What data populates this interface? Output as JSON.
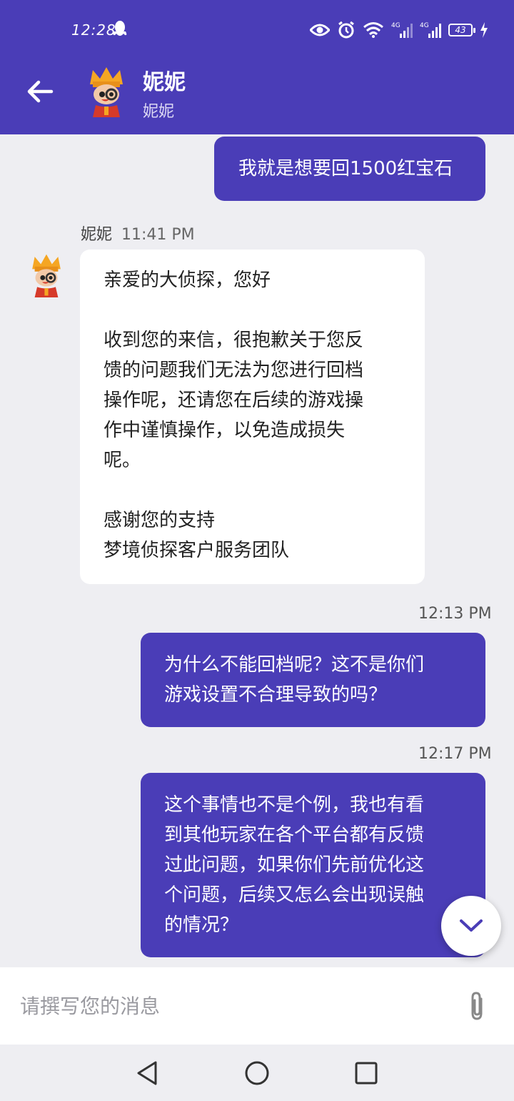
{
  "status_bar": {
    "time": "12:28",
    "battery": "43",
    "icons": [
      "qq-icon",
      "eye-icon",
      "alarm-icon",
      "wifi-icon",
      "signal-4g-icon",
      "signal-4g-icon",
      "battery-icon",
      "charging-icon"
    ]
  },
  "header": {
    "name": "妮妮",
    "subtitle": "妮妮",
    "back_icon": "arrow-left-icon"
  },
  "messages": [
    {
      "direction": "out",
      "lines": [
        "我就是想要回1500红宝石"
      ]
    },
    {
      "direction": "in",
      "sender": "妮妮",
      "time": "11:41 PM",
      "lines": [
        "亲爱的大侦探，您好",
        "",
        "收到您的来信，很抱歉关于您反",
        "馈的问题我们无法为您进行回档",
        "操作呢，还请您在后续的游戏操",
        "作中谨慎操作，以免造成损失",
        "呢。",
        "",
        "感谢您的支持",
        "梦境侦探客户服务团队"
      ]
    },
    {
      "direction": "out",
      "time": "12:13 PM",
      "lines": [
        "为什么不能回档呢？这不是你们",
        "游戏设置不合理导致的吗？"
      ]
    },
    {
      "direction": "out",
      "time": "12:17 PM",
      "lines": [
        "这个事情也不是个例，我也有看",
        "到其他玩家在各个平台都有反馈",
        "过此问题，如果你们先前优化这",
        "个问题，后续又怎么会出现误触",
        "的情况？"
      ]
    }
  ],
  "composer": {
    "placeholder": "请撰写您的消息",
    "value": ""
  },
  "colors": {
    "accent": "#4a3db7",
    "background": "#eeeef2",
    "incoming_bubble": "#ffffff"
  }
}
